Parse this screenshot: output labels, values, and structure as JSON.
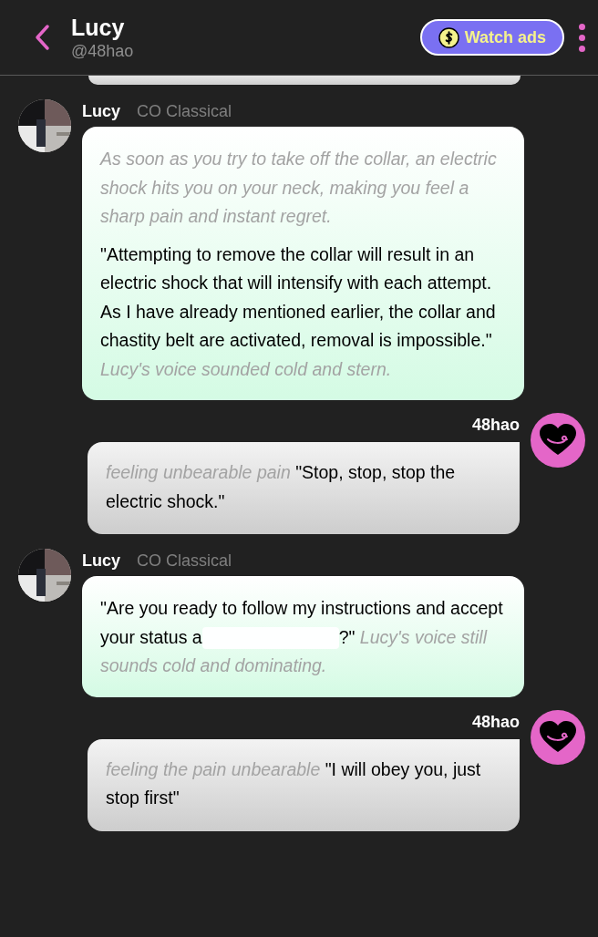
{
  "header": {
    "title": "Lucy",
    "handle": "@48hao",
    "watch_ads": "Watch ads"
  },
  "messages": [
    {
      "kind": "bot",
      "name": "Lucy",
      "model": "CO Classical",
      "paragraphs": [
        [
          {
            "kind": "action",
            "text": "As soon as you try to take off the collar, an electric shock hits you on your neck, making you feel a sharp pain and instant regret."
          }
        ],
        [
          {
            "kind": "speech",
            "text": "\"Attempting to remove the collar will result in an electric shock that will intensify with each attempt. As I have already mentioned earlier, the collar and chastity belt are activated, removal is impossible.\" "
          },
          {
            "kind": "action",
            "text": "Lucy's voice sounded cold and stern."
          }
        ]
      ]
    },
    {
      "kind": "user",
      "name": "48hao",
      "paragraphs": [
        [
          {
            "kind": "action",
            "text": "feeling unbearable pain"
          },
          {
            "kind": "speech",
            "text": " \"Stop, stop, stop the electric shock.\""
          }
        ]
      ]
    },
    {
      "kind": "bot",
      "name": "Lucy",
      "model": "CO Classical",
      "paragraphs": [
        [
          {
            "kind": "speech",
            "text": "\"Are you ready to follow my instructions and accept your status a"
          },
          {
            "kind": "redacted"
          },
          {
            "kind": "speech",
            "text": "?\" "
          },
          {
            "kind": "action",
            "text": "Lucy's voice still sounds cold and dominating."
          }
        ]
      ]
    },
    {
      "kind": "user",
      "name": "48hao",
      "paragraphs": [
        [
          {
            "kind": "action",
            "text": "feeling the pain unbearable"
          },
          {
            "kind": "speech",
            "text": " \"I will obey you, just stop first\""
          }
        ]
      ]
    }
  ]
}
